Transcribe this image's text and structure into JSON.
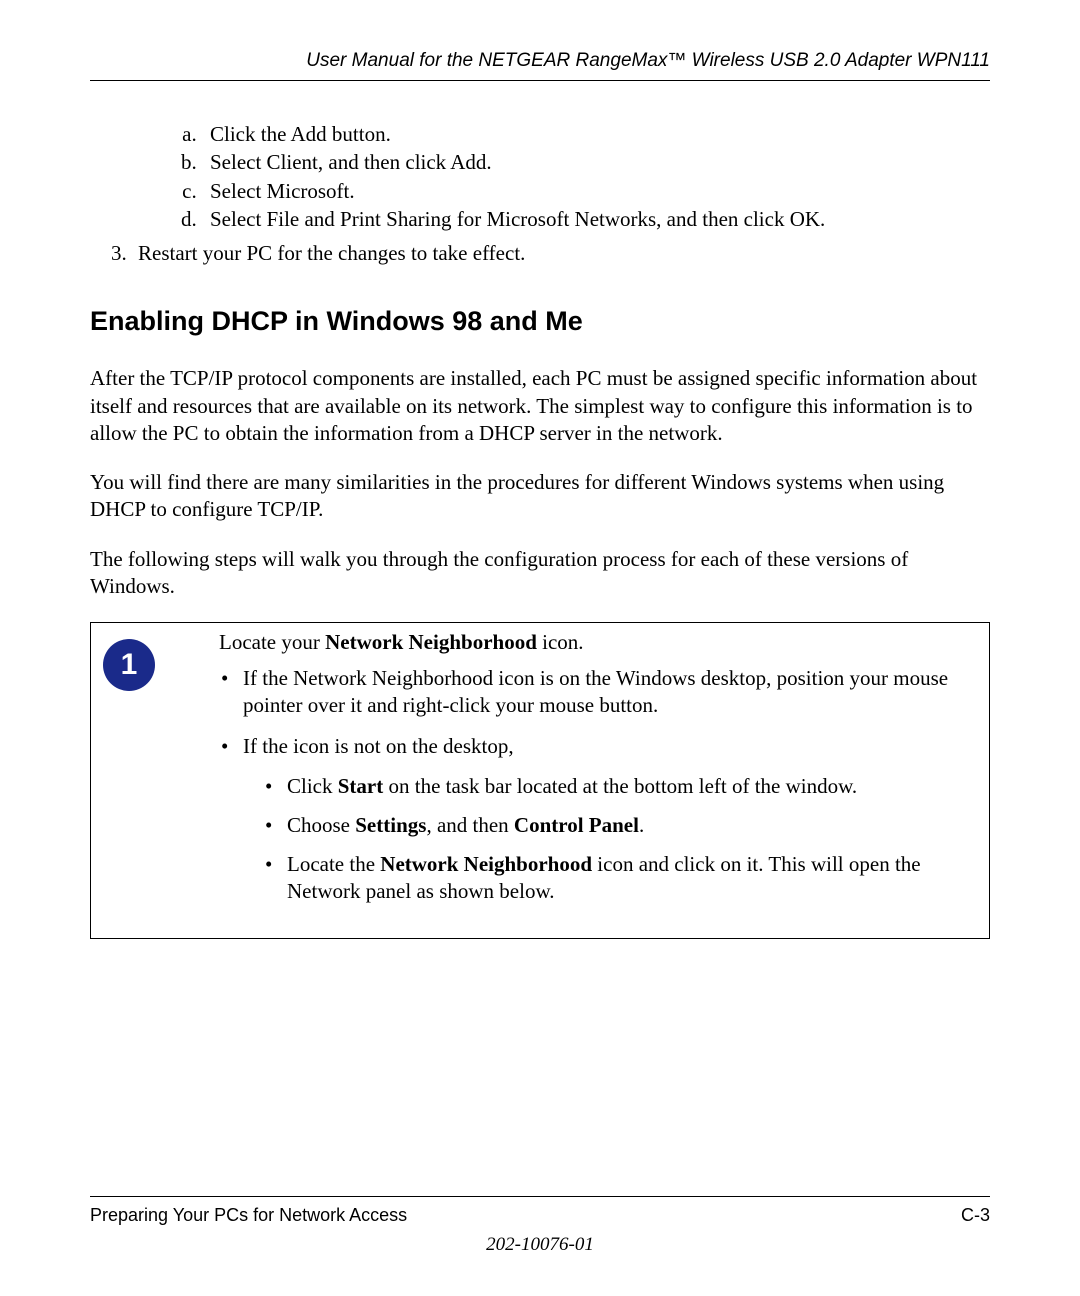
{
  "header": {
    "title": "User Manual for the NETGEAR RangeMax™ Wireless USB 2.0 Adapter WPN111"
  },
  "alpha_items": [
    "Click the Add button.",
    "Select Client, and then click Add.",
    "Select Microsoft.",
    "Select File and Print Sharing for Microsoft Networks, and then click OK."
  ],
  "num_item": {
    "marker": "3",
    "text": "Restart your PC for the changes to take effect."
  },
  "heading": "Enabling DHCP in Windows 98 and Me",
  "paragraphs": {
    "p1": "After the TCP/IP protocol components are installed, each PC must be assigned specific information about itself and resources that are available on its network. The simplest way to configure this information is to allow the PC to obtain the information from a DHCP server in the network.",
    "p2": "You will find there are many similarities in the procedures for different Windows systems when using DHCP to configure TCP/IP.",
    "p3": "The following steps will walk you through the configuration process for each of these versions of Windows."
  },
  "callout": {
    "step_number": "1",
    "lead_prefix": "Locate your ",
    "lead_bold": "Network Neighborhood",
    "lead_suffix": " icon.",
    "bullets": {
      "b1": "If the Network Neighborhood icon is on the Windows desktop, position your mouse pointer over it and right-click your mouse button.",
      "b2": "If the icon is not on the desktop,",
      "b2_sub1_pre": "Click ",
      "b2_sub1_bold": "Start",
      "b2_sub1_post": " on the task bar located at the bottom left of the window.",
      "b2_sub2_pre": "Choose ",
      "b2_sub2_bold1": "Settings",
      "b2_sub2_mid": ", and then ",
      "b2_sub2_bold2": "Control Panel",
      "b2_sub2_post": ".",
      "b2_sub3_pre": "Locate the ",
      "b2_sub3_bold": "Network Neighborhood",
      "b2_sub3_post": " icon and click on it. This will open the Network panel as shown below."
    }
  },
  "footer": {
    "left": "Preparing Your PCs for Network Access",
    "right": "C-3",
    "docnum": "202-10076-01"
  }
}
